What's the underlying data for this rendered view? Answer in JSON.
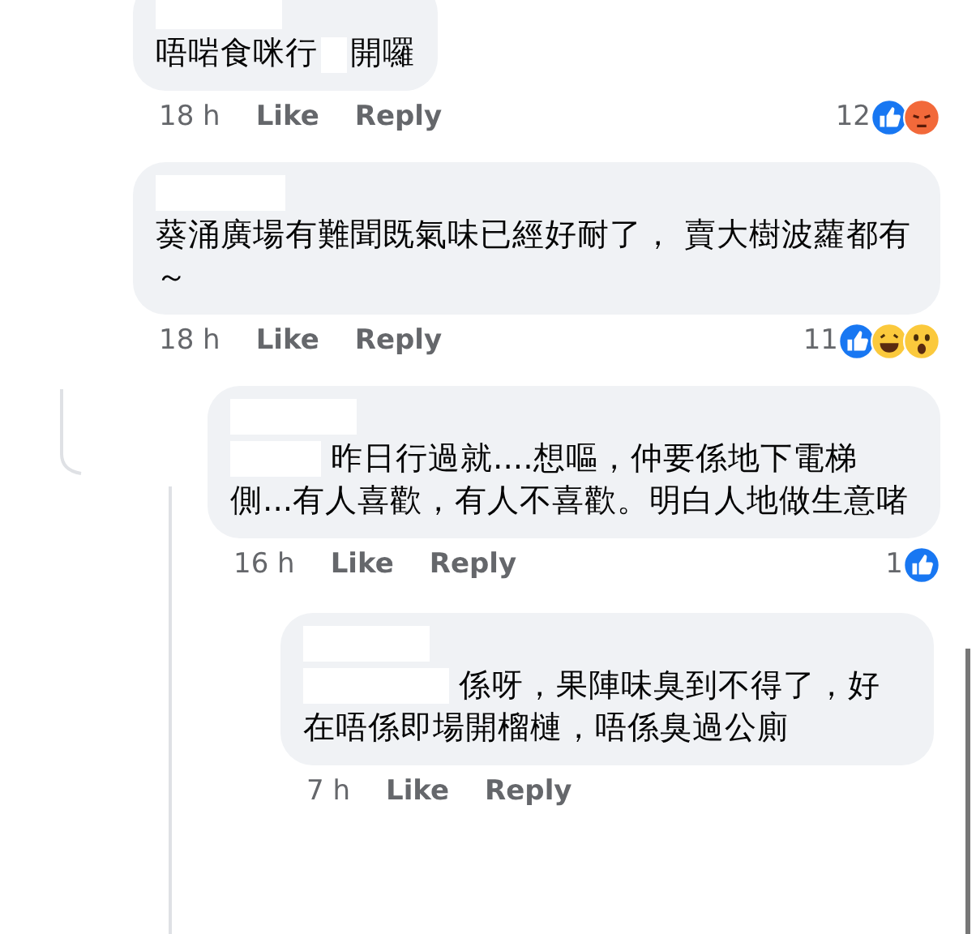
{
  "comments": [
    {
      "text_before": "唔啱食咪行",
      "text_after": "開囉",
      "time": "18 h",
      "like": "Like",
      "reply": "Reply",
      "count": "12",
      "reactions": [
        {
          "kind": "like"
        },
        {
          "kind": "angry"
        }
      ]
    },
    {
      "text_after": "葵涌廣場有難聞既氣味已經好耐了， 賣大樹波蘿都有～",
      "time": "18 h",
      "like": "Like",
      "reply": "Reply",
      "count": "11",
      "reactions": [
        {
          "kind": "like"
        },
        {
          "kind": "haha"
        },
        {
          "kind": "wow"
        }
      ]
    },
    {
      "text_after": "昨日行過就....想嘔，仲要係地下電梯側...有人喜歡，有人不喜歡。明白人地做生意啫",
      "time": "16 h",
      "like": "Like",
      "reply": "Reply",
      "count": "1",
      "reactions": [
        {
          "kind": "like"
        }
      ]
    },
    {
      "text_after": "係呀，果陣味臭到不得了，好在唔係即場開榴槤，唔係臭過公廁",
      "time": "7 h",
      "like": "Like",
      "reply": "Reply"
    }
  ]
}
